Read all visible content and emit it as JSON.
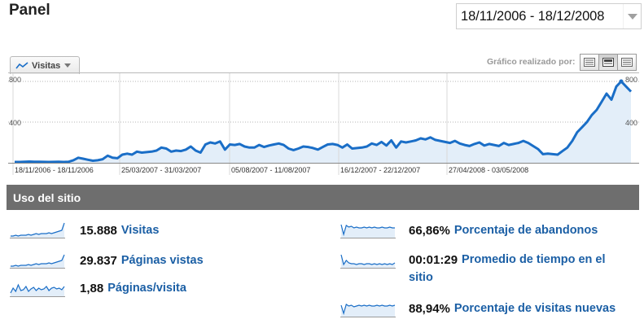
{
  "header": {
    "title": "Panel"
  },
  "date_picker": {
    "range": "18/11/2006 - 18/12/2008"
  },
  "metric_tab": {
    "label": "Visitas"
  },
  "chart_toolbar": {
    "label": "Gráfico realizado por:"
  },
  "chart_data": {
    "type": "area",
    "title": "",
    "xlabel": "",
    "ylabel": "",
    "ylim": [
      0,
      800
    ],
    "y_ticks_left": [
      "800",
      "400"
    ],
    "y_ticks_right": [
      "800",
      "400"
    ],
    "x_tick_labels": [
      "18/11/2006 - 18/11/2006",
      "25/03/2007 - 31/03/2007",
      "05/08/2007 - 11/08/2007",
      "16/12/2007 - 22/12/2007",
      "27/04/2008 - 03/05/2008"
    ],
    "grid": true,
    "series": [
      {
        "values": [
          8,
          8,
          10,
          12,
          10,
          10,
          9,
          8,
          9,
          10,
          8,
          10,
          25,
          50,
          40,
          30,
          20,
          25,
          35,
          70,
          50,
          45,
          80,
          90,
          80,
          110,
          100,
          105,
          110,
          120,
          150,
          140,
          110,
          120,
          115,
          130,
          160,
          120,
          100,
          180,
          200,
          190,
          210,
          130,
          180,
          175,
          185,
          160,
          150,
          150,
          175,
          155,
          170,
          180,
          190,
          175,
          140,
          125,
          140,
          160,
          155,
          145,
          130,
          155,
          180,
          185,
          175,
          150,
          180,
          140,
          145,
          150,
          160,
          190,
          175,
          205,
          170,
          220,
          150,
          210,
          200,
          210,
          220,
          240,
          230,
          250,
          225,
          215,
          205,
          195,
          215,
          190,
          175,
          165,
          185,
          200,
          170,
          185,
          175,
          165,
          195,
          175,
          185,
          195,
          215,
          195,
          165,
          135,
          85,
          90,
          85,
          80,
          115,
          150,
          215,
          300,
          350,
          400,
          470,
          520,
          600,
          680,
          620,
          750,
          800,
          750,
          700
        ]
      }
    ],
    "line_color": "#1a6ec7",
    "fill_color": "#e3eef9"
  },
  "usage": {
    "title": "Uso del sitio",
    "stats": [
      {
        "value": "15.888",
        "label": "Visitas"
      },
      {
        "value": "29.837",
        "label": "Páginas vistas"
      },
      {
        "value": "1,88",
        "label": "Páginas/visita"
      },
      {
        "value": "66,86%",
        "label": "Porcentaje de abandonos"
      },
      {
        "value": "00:01:29",
        "label": "Promedio de tiempo en el",
        "label_cont": "sitio"
      },
      {
        "value": "88,94%",
        "label": "Porcentaje de visitas nuevas"
      }
    ]
  },
  "colors": {
    "link": "#1b5fa5",
    "header_bar": "#6e6e6e",
    "accent_line": "#1a6ec7"
  }
}
